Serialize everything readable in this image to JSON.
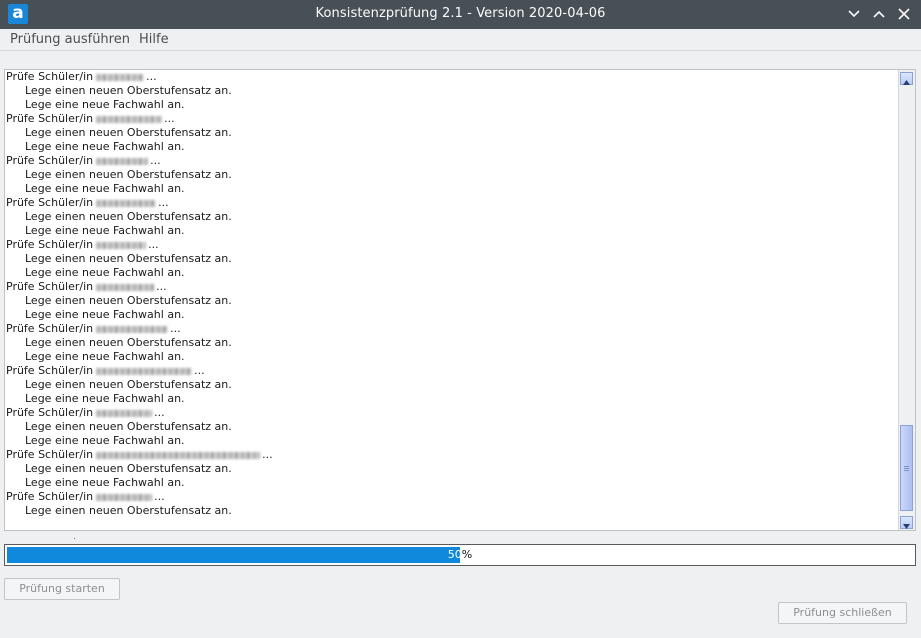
{
  "window": {
    "title": "Konsistenzprüfung 2.1 - Version 2020-04-06",
    "app_icon_letter": "a"
  },
  "menu": {
    "items": [
      {
        "label": "Prüfung ausführen"
      },
      {
        "label": "Hilfe"
      }
    ]
  },
  "log": {
    "check_prefix": "Prüfe Schüler/in",
    "action_oberstufensatz": "Lege einen neuen Oberstufensatz an.",
    "action_fachwahl": "Lege eine neue Fachwahl an.",
    "ellipsis": "...",
    "lines": [
      {
        "type": "check"
      },
      {
        "type": "o"
      },
      {
        "type": "f"
      },
      {
        "type": "check"
      },
      {
        "type": "o"
      },
      {
        "type": "f"
      },
      {
        "type": "check"
      },
      {
        "type": "o"
      },
      {
        "type": "f"
      },
      {
        "type": "check"
      },
      {
        "type": "o"
      },
      {
        "type": "f"
      },
      {
        "type": "check"
      },
      {
        "type": "o"
      },
      {
        "type": "f"
      },
      {
        "type": "check"
      },
      {
        "type": "o"
      },
      {
        "type": "f"
      },
      {
        "type": "check"
      },
      {
        "type": "o"
      },
      {
        "type": "f"
      },
      {
        "type": "check"
      },
      {
        "type": "o"
      },
      {
        "type": "f"
      },
      {
        "type": "check"
      },
      {
        "type": "o"
      },
      {
        "type": "f"
      },
      {
        "type": "check"
      },
      {
        "type": "o"
      },
      {
        "type": "f"
      },
      {
        "type": "check"
      },
      {
        "type": "o"
      }
    ]
  },
  "progress": {
    "value": "50",
    "unit": "%",
    "fraction": 0.5
  },
  "buttons": {
    "start_label": "Prüfung starten",
    "close_label": "Prüfung schließen"
  },
  "colors": {
    "titlebar": "#475057",
    "progress_fill": "#1089dc"
  }
}
